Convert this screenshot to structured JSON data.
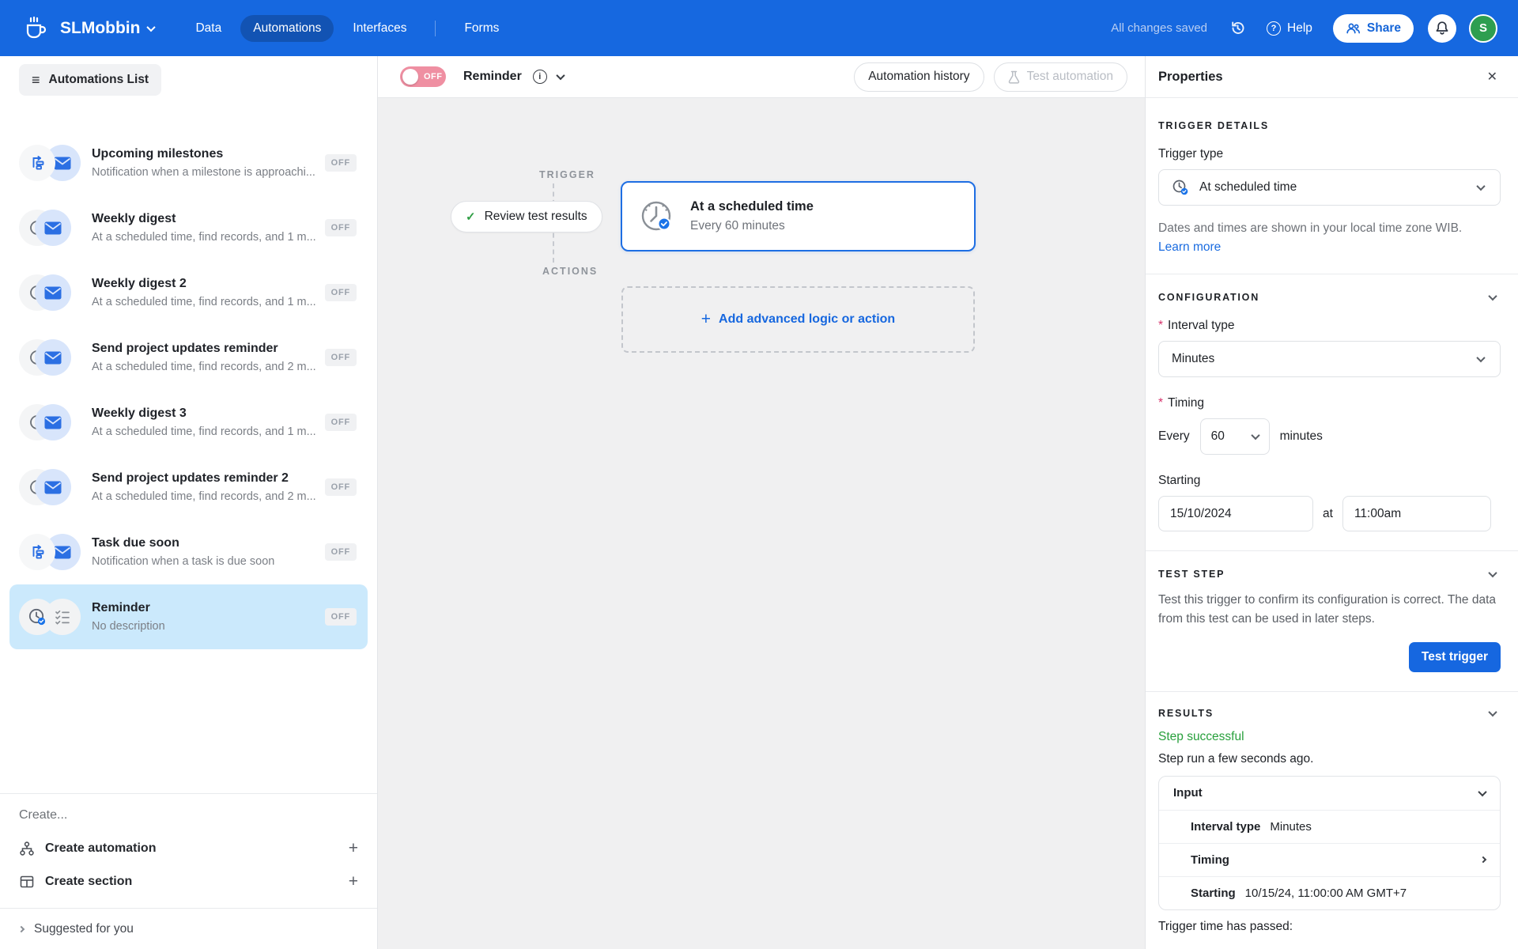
{
  "topnav": {
    "app_name": "SLMobbin",
    "tabs": [
      {
        "label": "Data",
        "active": false
      },
      {
        "label": "Automations",
        "active": true
      },
      {
        "label": "Interfaces",
        "active": false
      },
      {
        "label": "Forms",
        "active": false
      }
    ],
    "status": "All changes saved",
    "help_label": "Help",
    "share_label": "Share",
    "avatar_initial": "S"
  },
  "sidebar": {
    "header": "Automations List",
    "items": [
      {
        "title": "Upcoming milestones",
        "desc": "Notification when a milestone is approachi...",
        "state": "OFF",
        "selected": false,
        "icons": [
          "flowchart-icon",
          "envelope-icon"
        ]
      },
      {
        "title": "Weekly digest",
        "desc": "At a scheduled time, find records, and 1 m...",
        "state": "OFF",
        "selected": false,
        "icons": [
          "clock-icon",
          "envelope-icon"
        ]
      },
      {
        "title": "Weekly digest 2",
        "desc": "At a scheduled time, find records, and 1 m...",
        "state": "OFF",
        "selected": false,
        "icons": [
          "clock-icon",
          "envelope-icon"
        ]
      },
      {
        "title": "Send project updates reminder",
        "desc": "At a scheduled time, find records, and 2 m...",
        "state": "OFF",
        "selected": false,
        "icons": [
          "clock-icon",
          "envelope-icon"
        ]
      },
      {
        "title": "Weekly digest 3",
        "desc": "At a scheduled time, find records, and 1 m...",
        "state": "OFF",
        "selected": false,
        "icons": [
          "clock-icon",
          "envelope-icon"
        ]
      },
      {
        "title": "Send project updates reminder 2",
        "desc": "At a scheduled time, find records, and 2 m...",
        "state": "OFF",
        "selected": false,
        "icons": [
          "clock-icon",
          "envelope-icon"
        ]
      },
      {
        "title": "Task due soon",
        "desc": "Notification when a task is due soon",
        "state": "OFF",
        "selected": false,
        "icons": [
          "flowchart-icon",
          "envelope-icon"
        ]
      },
      {
        "title": "Reminder",
        "desc": "No description",
        "state": "OFF",
        "selected": true,
        "icons": [
          "clock-check-icon",
          "checklist-icon"
        ]
      }
    ],
    "create_header": "Create...",
    "create_automation": "Create automation",
    "create_section": "Create section",
    "suggested": "Suggested for you"
  },
  "canvas": {
    "toggle_label": "OFF",
    "title": "Reminder",
    "history_button": "Automation history",
    "test_button": "Test automation",
    "trigger_label": "TRIGGER",
    "actions_label": "ACTIONS",
    "review_button": "Review test results",
    "check_mark": "✓",
    "card_title": "At a scheduled time",
    "card_subtitle": "Every 60 minutes",
    "plus": "+",
    "add_action": "Add advanced logic or action"
  },
  "properties": {
    "title": "Properties",
    "trigger_details": {
      "header": "TRIGGER DETAILS",
      "trigger_type_label": "Trigger type",
      "trigger_type_value": "At scheduled time",
      "timezone_note": "Dates and times are shown in your local time zone WIB.",
      "learn_more": "Learn more"
    },
    "configuration": {
      "header": "CONFIGURATION",
      "required_marker": "*",
      "interval_label": "Interval type",
      "interval_value": "Minutes",
      "timing_label": "Timing",
      "every": "Every",
      "every_value": "60",
      "unit": "minutes",
      "starting_label": "Starting",
      "date_value": "15/10/2024",
      "at": "at",
      "time_value": "11:00am"
    },
    "test_step": {
      "header": "TEST STEP",
      "description": "Test this trigger to confirm its configuration is correct. The data from this test can be used in later steps.",
      "button": "Test trigger"
    },
    "results": {
      "header": "RESULTS",
      "status": "Step successful",
      "run_info": "Step run a few seconds ago.",
      "input_header": "Input",
      "rows": [
        {
          "label": "Interval type",
          "value": "Minutes"
        },
        {
          "label": "Timing",
          "value": ""
        },
        {
          "label": "Starting",
          "value": "10/15/24, 11:00:00 AM GMT+7"
        }
      ],
      "footer": "Trigger time has passed:"
    }
  },
  "colors": {
    "nav_blue": "#1668e0",
    "active_tab_blue": "#1256c0",
    "accent_blue": "#1667e0",
    "card_border_blue": "#1e6ee3",
    "link_blue": "#1b6ce0",
    "success_green": "#2f9e44",
    "step_success_green": "#28a03c",
    "toggle_off_pink": "#ef8fa2",
    "selected_row_blue": "#cbe9fc",
    "avatar_green": "#2e9e50",
    "required_red": "#d6336c",
    "disabled_text": "#b9bdc4"
  }
}
